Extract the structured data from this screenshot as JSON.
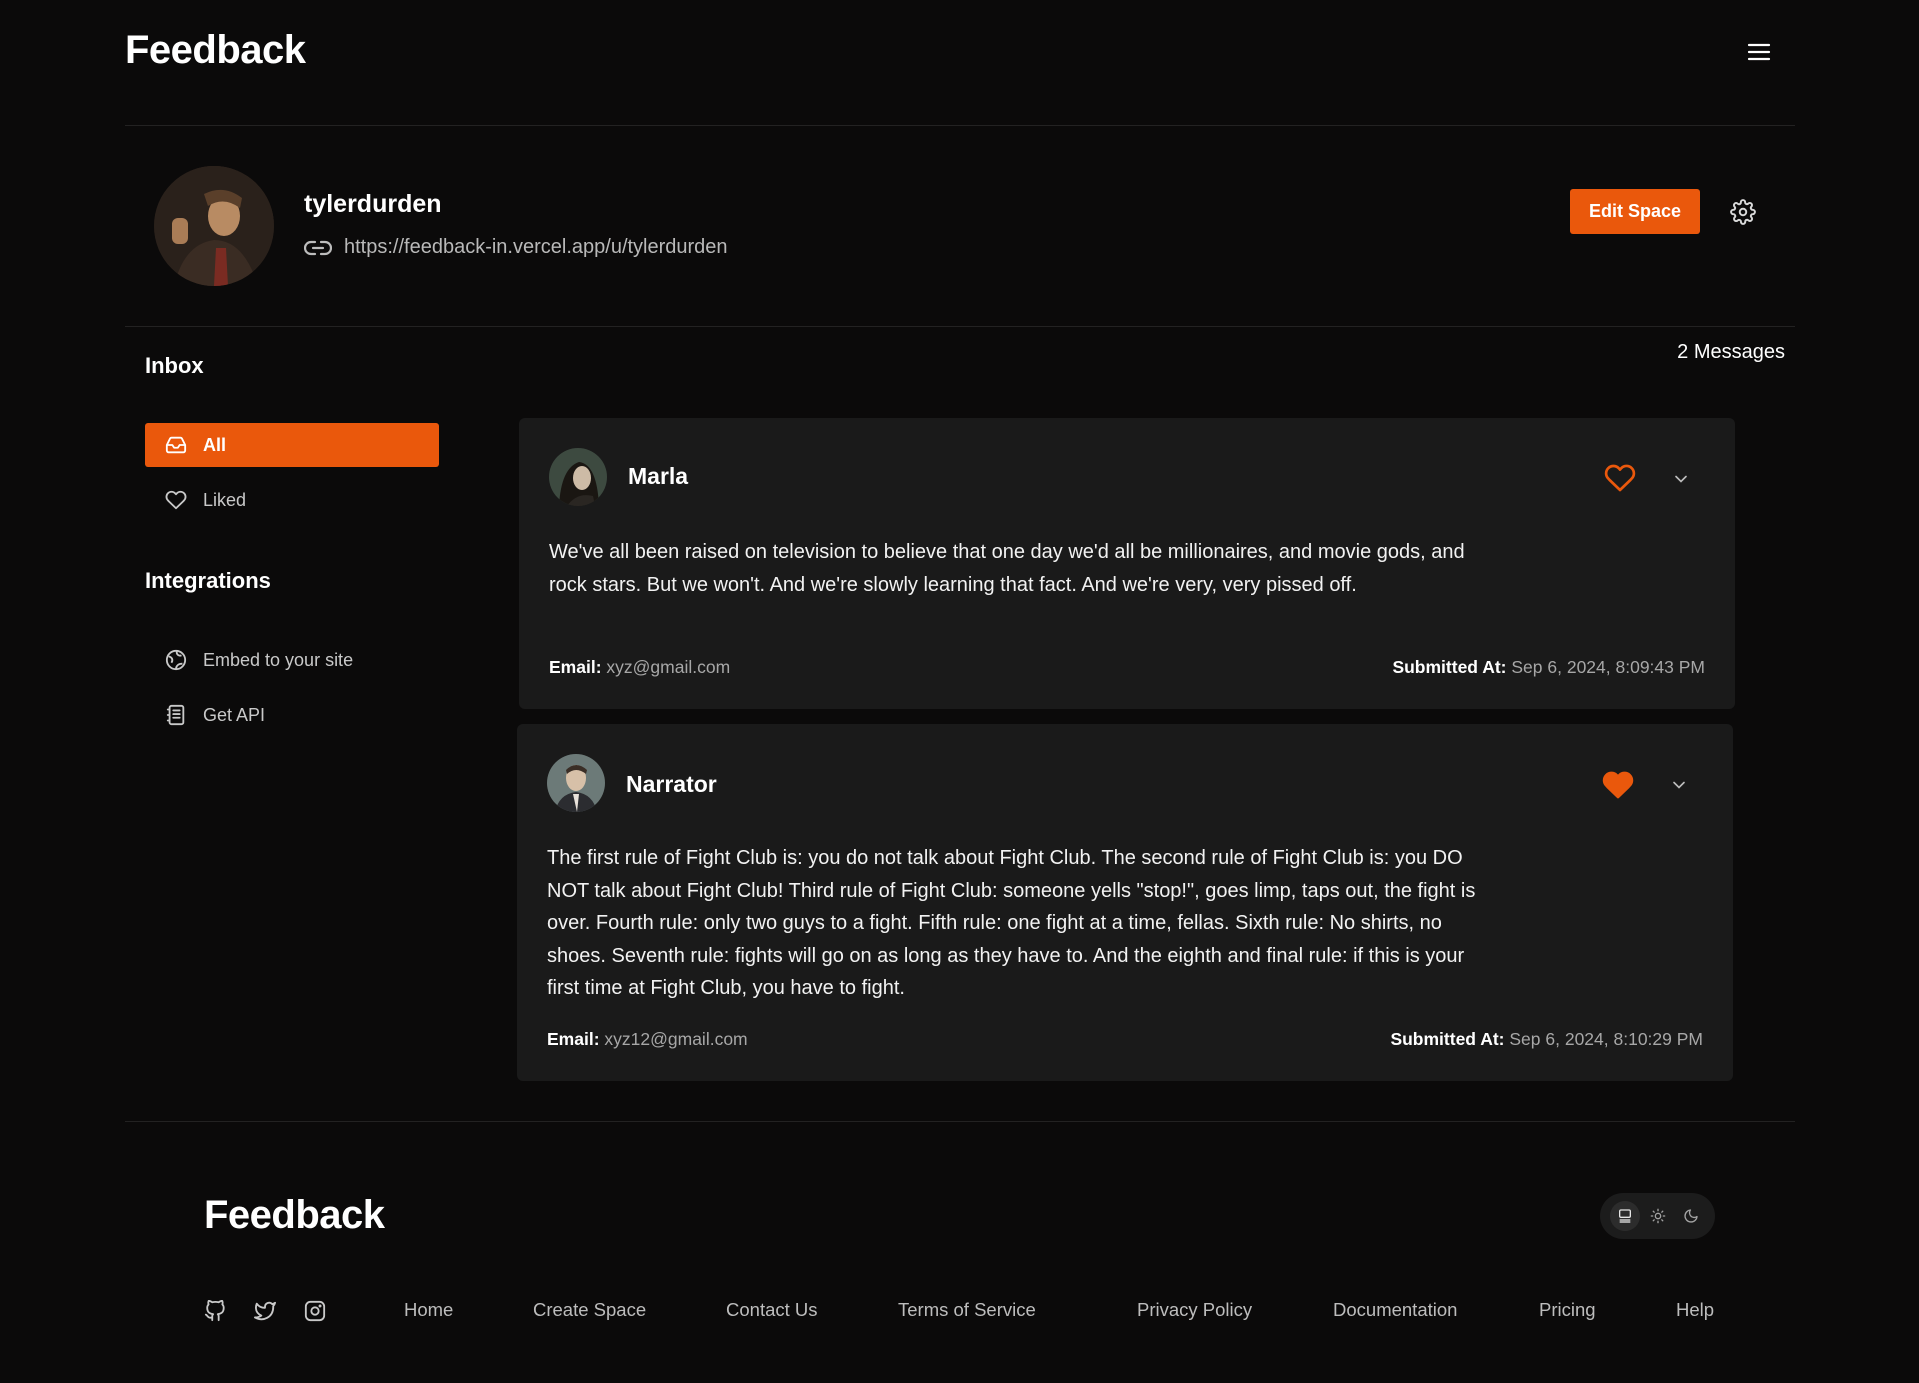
{
  "header": {
    "brand": "Feedback",
    "menu_icon": "hamburger-menu-icon"
  },
  "profile": {
    "username": "tylerdurden",
    "link": "https://feedback-in.vercel.app/u/tylerdurden",
    "edit_button": "Edit Space"
  },
  "sidebar": {
    "inbox_heading": "Inbox",
    "inbox_items": [
      {
        "label": "All",
        "icon": "inbox-icon",
        "active": true
      },
      {
        "label": "Liked",
        "icon": "heart-icon",
        "active": false
      }
    ],
    "integrations_heading": "Integrations",
    "integration_items": [
      {
        "label": "Embed to your site",
        "icon": "globe-icon"
      },
      {
        "label": "Get API",
        "icon": "document-icon"
      }
    ]
  },
  "messages": {
    "count_label": "2 Messages",
    "items": [
      {
        "name": "Marla",
        "liked": false,
        "text": "We've all been raised on television to believe that one day we'd all be millionaires, and movie gods, and rock stars. But we won't. And we're slowly learning that fact. And we're very, very pissed off.",
        "email_label": "Email:",
        "email": "xyz@gmail.com",
        "submitted_label": "Submitted At:",
        "submitted": "Sep 6, 2024, 8:09:43 PM"
      },
      {
        "name": "Narrator",
        "liked": true,
        "text": "The first rule of Fight Club is: you do not talk about Fight Club. The second rule of Fight Club is: you DO NOT talk about Fight Club! Third rule of Fight Club: someone yells \"stop!\", goes limp, taps out, the fight is over. Fourth rule: only two guys to a fight. Fifth rule: one fight at a time, fellas. Sixth rule: No shirts, no shoes. Seventh rule: fights will go on as long as they have to. And the eighth and final rule: if this is your first time at Fight Club, you have to fight.",
        "email_label": "Email:",
        "email": "xyz12@gmail.com",
        "submitted_label": "Submitted At:",
        "submitted": "Sep 6, 2024, 8:10:29 PM"
      }
    ]
  },
  "footer": {
    "brand": "Feedback",
    "theme_options": [
      "system",
      "light",
      "dark"
    ],
    "theme_selected": "system",
    "social_icons": [
      "github-icon",
      "twitter-icon",
      "instagram-icon"
    ],
    "links": [
      "Home",
      "Create Space",
      "Contact Us",
      "Terms of Service",
      "Privacy Policy",
      "Documentation",
      "Pricing",
      "Help"
    ]
  },
  "colors": {
    "accent": "#ea580c",
    "background": "#0b0a0a",
    "card": "#1a1a1a",
    "divider": "#232222"
  }
}
